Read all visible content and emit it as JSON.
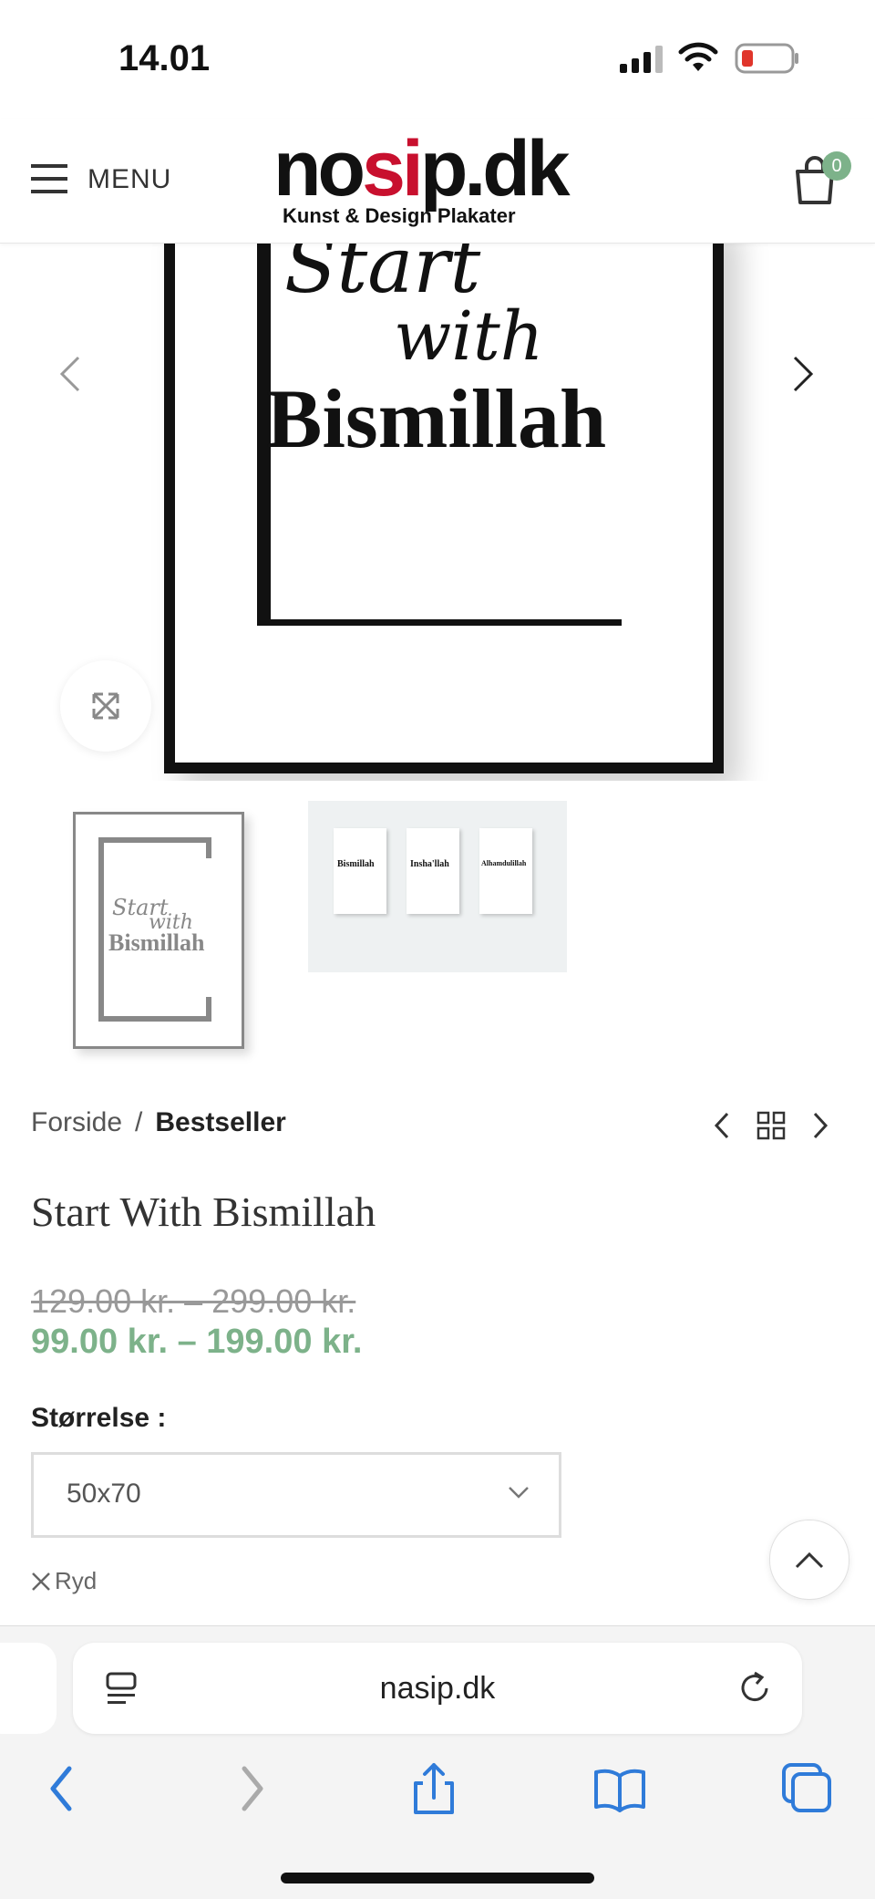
{
  "status_bar": {
    "time": "14.01"
  },
  "header": {
    "menu_label": "MENU",
    "logo_main_a": "no",
    "logo_main_b": "si",
    "logo_main_c": "p.dk",
    "logo_sub": "Kunst & Design Plakater",
    "cart_count": "0"
  },
  "gallery": {
    "poster_line1": "Start",
    "poster_line2": "with",
    "poster_line3": "Bismillah",
    "thumb1_line1": "Start",
    "thumb1_line2": "with",
    "thumb1_line3": "Bismillah",
    "thumb2_labels": [
      "Bismillah",
      "Insha'llah",
      "Alhamdulillah"
    ]
  },
  "breadcrumb": {
    "home": "Forside",
    "separator": "/",
    "current": "Bestseller"
  },
  "product": {
    "title": "Start With Bismillah",
    "old_price": "129.00 kr. – 299.00 kr.",
    "new_price": "99.00 kr. – 199.00 kr.",
    "size_label": "Størrelse :",
    "size_value": "50x70",
    "clear_label": "Ryd"
  },
  "safari": {
    "url": "nasip.dk"
  },
  "colors": {
    "accent_green": "#7db28a",
    "logo_red": "#c8102e",
    "safari_blue": "#2f7bd9"
  }
}
